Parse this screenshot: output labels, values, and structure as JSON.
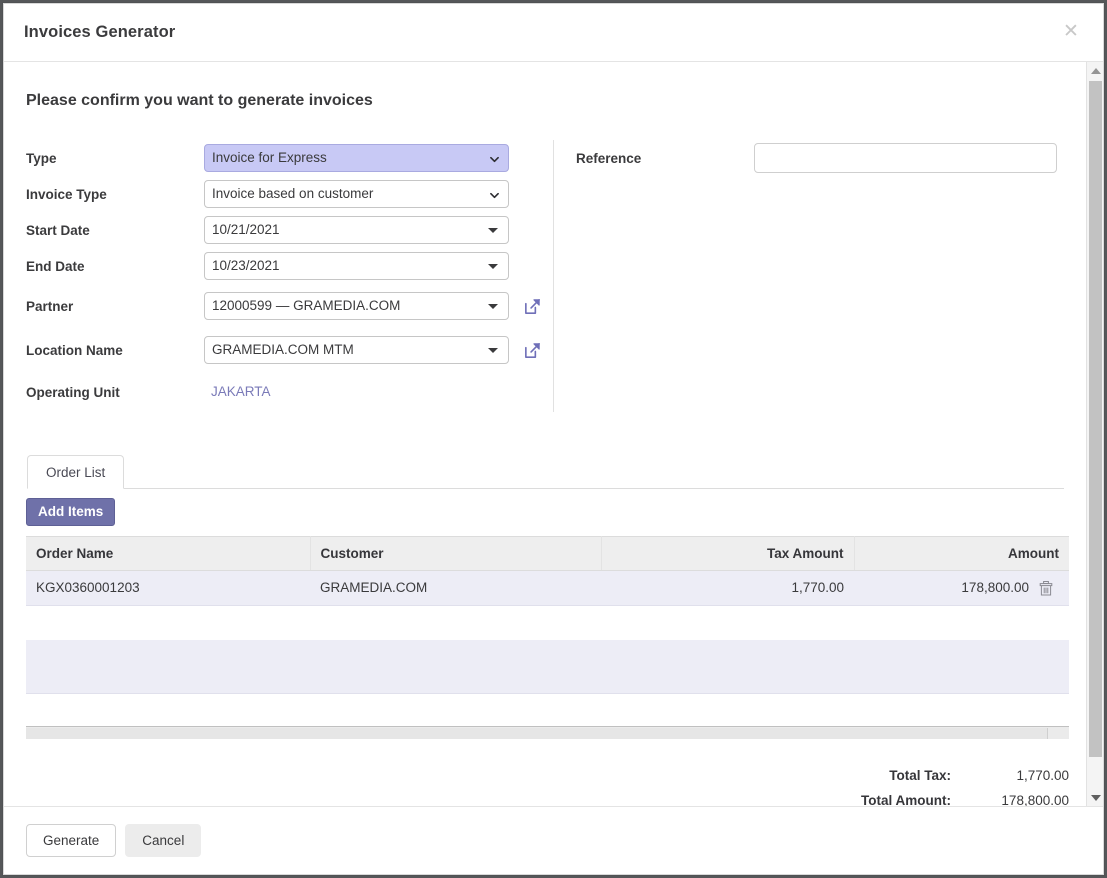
{
  "dialog": {
    "title": "Invoices Generator",
    "close_icon": "close-icon",
    "heading": "Please confirm you want to generate invoices"
  },
  "form": {
    "fields": [
      {
        "label": "Type",
        "value": "Invoice for Express"
      },
      {
        "label": "Invoice Type",
        "value": "Invoice based on customer"
      },
      {
        "label": "Start Date",
        "value": "10/21/2021"
      },
      {
        "label": "End Date",
        "value": "10/23/2021"
      },
      {
        "label": "Partner",
        "value": "12000599 — GRAMEDIA.COM"
      },
      {
        "label": "Location Name",
        "value": "GRAMEDIA.COM MTM"
      },
      {
        "label": "Operating Unit",
        "value": "JAKARTA"
      }
    ],
    "reference": {
      "label": "Reference",
      "value": "",
      "placeholder": ""
    },
    "open_icon": "external-link-icon"
  },
  "tabs": [
    {
      "label": "Order List",
      "active": true
    }
  ],
  "toolbar": {
    "add_items_label": "Add Items"
  },
  "table": {
    "columns": [
      "Order Name",
      "Customer",
      "Tax Amount",
      "Amount"
    ],
    "rows": [
      {
        "order_name": "KGX0360001203",
        "customer": "GRAMEDIA.COM",
        "tax_amount": "1,770.00",
        "amount": "178,800.00",
        "delete_icon": "trash-icon"
      }
    ]
  },
  "totals": [
    {
      "label": "Total Tax:",
      "value": "1,770.00"
    },
    {
      "label": "Total Amount:",
      "value": "178,800.00"
    }
  ],
  "footer": {
    "generate_label": "Generate",
    "cancel_label": "Cancel"
  },
  "colors": {
    "accent_purple": "#6f71a9",
    "highlight_select": "#c8c9f5",
    "row_lavender": "#ededf6",
    "header_gray": "#eeeeee",
    "link_text": "#7a7ab8"
  }
}
